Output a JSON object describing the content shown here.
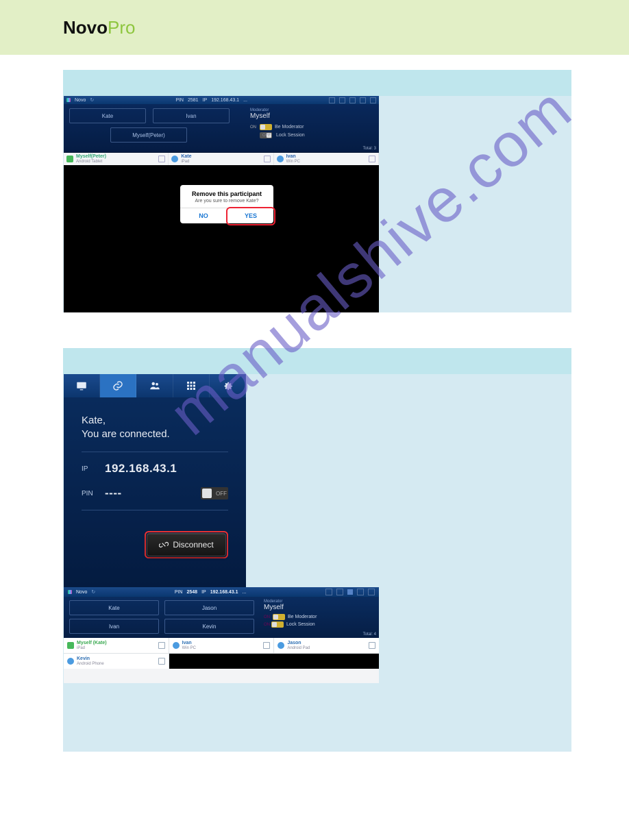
{
  "header": {
    "logo_part1": "Novo",
    "logo_part2": "Pro"
  },
  "watermark": "manualshive.com",
  "shot1": {
    "top": {
      "title": "Novo",
      "pin_label": "PIN",
      "pin": "2581",
      "ip_label": "IP",
      "ip": "192.168.43.1",
      "more": "..."
    },
    "slots": [
      "Kate",
      "Ivan",
      "Myself(Peter)"
    ],
    "mod": {
      "label": "Moderator",
      "name": "Myself",
      "be_moderator": "Be Moderator",
      "lock_session": "Lock Session",
      "on": "ON",
      "off": "OFF",
      "total_label": "Total:",
      "total": "3"
    },
    "cards": [
      {
        "name": "Myself(Peter)",
        "device": "Android Tablet"
      },
      {
        "name": "Kate",
        "device": "iPad"
      },
      {
        "name": "Ivan",
        "device": "Win PC"
      }
    ],
    "dialog": {
      "title": "Remove this participant",
      "msg": "Are you sure to remove Kate?",
      "no": "NO",
      "yes": "YES"
    }
  },
  "shot2": {
    "greet_line1": "Kate,",
    "greet_line2": "You are connected.",
    "ip_label": "IP",
    "ip": "192.168.43.1",
    "pin_label": "PIN",
    "pin": "----",
    "pin_toggle": "OFF",
    "disconnect": "Disconnect"
  },
  "shot3": {
    "top": {
      "title": "Novo",
      "pin_label": "PIN",
      "pin": "2548",
      "ip_label": "IP",
      "ip": "192.168.43.1",
      "more": "..."
    },
    "slots": [
      "Kate",
      "Jason",
      "Ivan",
      "Kevin"
    ],
    "mod": {
      "label": "Moderator",
      "name": "Myself",
      "be_moderator": "Be Moderator",
      "lock_session": "Lock Session",
      "on": "ON",
      "total_label": "Total:",
      "total": "4"
    },
    "cards": [
      {
        "name": "Myself (Kate)",
        "device": "iPad"
      },
      {
        "name": "Ivan",
        "device": "Win PC"
      },
      {
        "name": "Jason",
        "device": "Android Pad"
      },
      {
        "name": "Kevin",
        "device": "Android Phone"
      }
    ]
  }
}
